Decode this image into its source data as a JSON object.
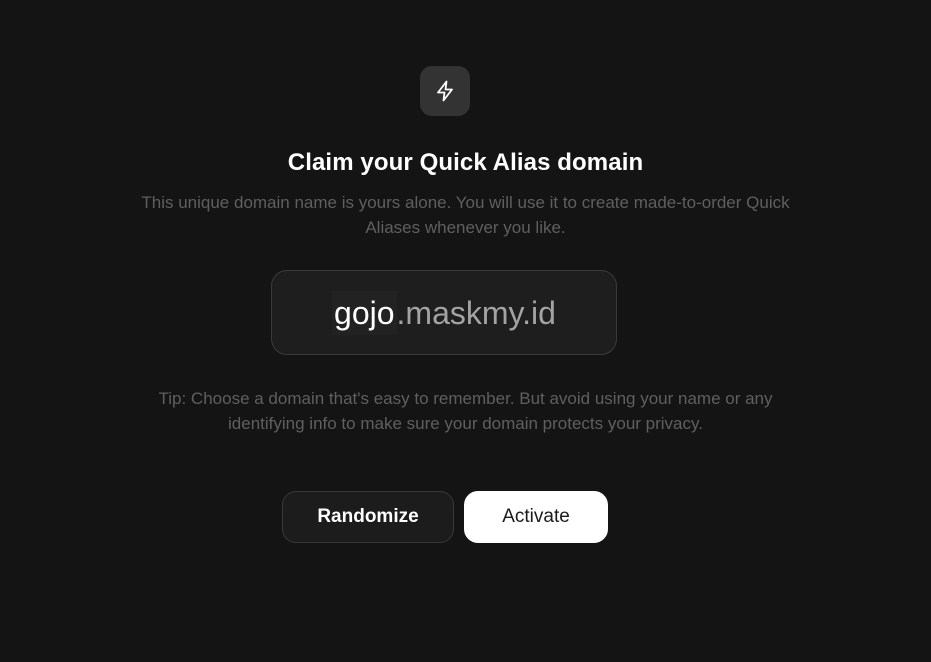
{
  "header": {
    "icon": "lightning-bolt-icon",
    "title": "Claim your Quick Alias domain",
    "subtitle": "This unique domain name is yours alone. You will use it to create made-to-order Quick Aliases whenever you like."
  },
  "domain": {
    "prefix": "gojo",
    "suffix": ".maskmy.id"
  },
  "tip": "Tip: Choose a domain that's easy to remember. But avoid using your name or any identifying info to make sure your domain protects your privacy.",
  "actions": {
    "randomize_label": "Randomize",
    "activate_label": "Activate"
  },
  "colors": {
    "background": "#141414",
    "primary_button": "#ffffff",
    "muted_text": "#5f5f5f"
  }
}
